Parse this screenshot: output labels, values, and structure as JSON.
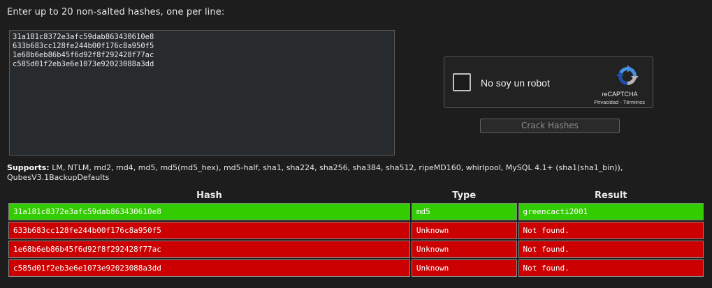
{
  "instructions": "Enter up to 20 non-salted hashes, one per line:",
  "textarea": {
    "value": "31a181c8372e3afc59dab863430610e8\n633b683cc128fe244b00f176c8a950f5\n1e68b6eb86b45f6d92f8f292428f77ac\nc585d01f2eb3e6e1073e92023088a3dd"
  },
  "captcha": {
    "label": "No soy un robot",
    "brand": "reCAPTCHA",
    "privacy": "Privacidad",
    "separator": " - ",
    "terms": "Términos",
    "icon": "recaptcha-logo-icon"
  },
  "crack_button": "Crack Hashes",
  "supports": {
    "label": "Supports:",
    "text": " LM, NTLM, md2, md4, md5, md5(md5_hex), md5-half, sha1, sha224, sha256, sha384, sha512, ripeMD160, whirlpool, MySQL 4.1+ (sha1(sha1_bin)), QubesV3.1BackupDefaults"
  },
  "table": {
    "headers": [
      "Hash",
      "Type",
      "Result"
    ],
    "rows": [
      {
        "hash": "31a181c8372e3afc59dab863430610e8",
        "type": "md5",
        "result": "greencacti2001"
      },
      {
        "hash": "633b683cc128fe244b00f176c8a950f5",
        "type": "Unknown",
        "result": "Not found."
      },
      {
        "hash": "1e68b6eb86b45f6d92f8f292428f77ac",
        "type": "Unknown",
        "result": "Not found."
      },
      {
        "hash": "c585d01f2eb3e6e1073e92023088a3dd",
        "type": "Unknown",
        "result": "Not found."
      }
    ]
  },
  "colors": {
    "background": "#1d1d1d",
    "found": "#33cc00",
    "not_found": "#cc0000"
  }
}
